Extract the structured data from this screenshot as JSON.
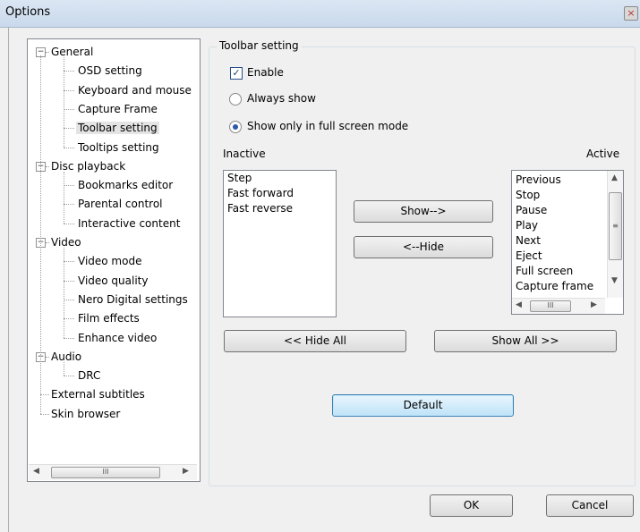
{
  "window": {
    "title": "Options",
    "close_glyph": "×"
  },
  "tree": {
    "items": [
      {
        "label": "General",
        "level": 0,
        "expander": "−"
      },
      {
        "label": "OSD setting",
        "level": 1
      },
      {
        "label": "Keyboard and mouse",
        "level": 1
      },
      {
        "label": "Capture Frame",
        "level": 1
      },
      {
        "label": "Toolbar setting",
        "level": 1,
        "selected": true
      },
      {
        "label": "Tooltips setting",
        "level": 1
      },
      {
        "label": "Disc playback",
        "level": 0,
        "expander": "−"
      },
      {
        "label": "Bookmarks editor",
        "level": 1
      },
      {
        "label": "Parental control",
        "level": 1
      },
      {
        "label": "Interactive content",
        "level": 1
      },
      {
        "label": "Video",
        "level": 0,
        "expander": "−"
      },
      {
        "label": "Video mode",
        "level": 1
      },
      {
        "label": "Video quality",
        "level": 1
      },
      {
        "label": "Nero Digital settings",
        "level": 1
      },
      {
        "label": "Film effects",
        "level": 1
      },
      {
        "label": "Enhance video",
        "level": 1
      },
      {
        "label": "Audio",
        "level": 0,
        "expander": "−"
      },
      {
        "label": "DRC",
        "level": 1
      },
      {
        "label": "External subtitles",
        "level": 0
      },
      {
        "label": "Skin browser",
        "level": 0
      }
    ],
    "scroll_thumb_glyph": "III"
  },
  "toolbar_setting": {
    "group_title": "Toolbar setting",
    "enable_label": "Enable",
    "enable_checked": true,
    "always_show_label": "Always show",
    "fullscreen_label": "Show only in full screen mode",
    "selected_mode": "fullscreen",
    "inactive_label": "Inactive",
    "active_label": "Active",
    "inactive_items": [
      "Step",
      "Fast forward",
      "Fast reverse"
    ],
    "active_items": [
      "Previous",
      "Stop",
      "Pause",
      "Play",
      "Next",
      "Eject",
      "Full screen",
      "Capture frame"
    ],
    "show_button": "Show-->",
    "hide_button": "<--Hide",
    "hide_all_button": "<< Hide All",
    "show_all_button": "Show All >>",
    "default_button": "Default"
  },
  "footer": {
    "ok_button": "OK",
    "cancel_button": "Cancel"
  }
}
